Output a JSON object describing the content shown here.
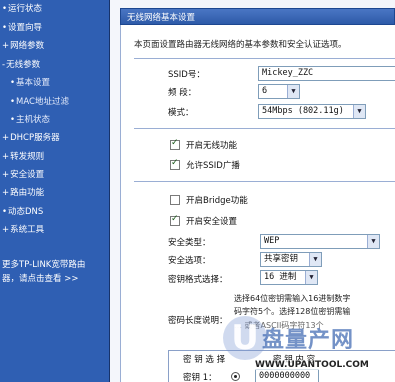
{
  "sidebar": {
    "items": [
      {
        "label": "运行状态",
        "bullet": "•"
      },
      {
        "label": "设置向导",
        "bullet": "•"
      },
      {
        "label": "网络参数",
        "bullet": "+"
      },
      {
        "label": "无线参数",
        "bullet": "-"
      },
      {
        "label": "基本设置",
        "bullet": "•"
      },
      {
        "label": "MAC地址过滤",
        "bullet": "•"
      },
      {
        "label": "主机状态",
        "bullet": "•"
      },
      {
        "label": "DHCP服务器",
        "bullet": "+"
      },
      {
        "label": "转发规则",
        "bullet": "+"
      },
      {
        "label": "安全设置",
        "bullet": "+"
      },
      {
        "label": "路由功能",
        "bullet": "+"
      },
      {
        "label": "动态DNS",
        "bullet": "•"
      },
      {
        "label": "系统工具",
        "bullet": "+"
      }
    ],
    "promo_line1": "更多TP-LINK宽带路由",
    "promo_line2": "器，请点击查看 >>"
  },
  "panel": {
    "title": "无线网络基本设置",
    "description": "本页面设置路由器无线网络的基本参数和安全认证选项。"
  },
  "form": {
    "ssid_label": "SSID号：",
    "ssid_value": "Mickey_ZZC",
    "channel_label": "频 段：",
    "channel_value": "6",
    "mode_label": "模式：",
    "mode_value": "54Mbps (802.11g)",
    "enable_wireless_label": "开启无线功能",
    "enable_wireless_checked": true,
    "allow_ssid_broadcast_label": "允许SSID广播",
    "allow_ssid_broadcast_checked": true,
    "enable_bridge_label": "开启Bridge功能",
    "enable_bridge_checked": false,
    "enable_security_label": "开启安全设置",
    "enable_security_checked": true,
    "security_type_label": "安全类型：",
    "security_type_value": "WEP",
    "security_option_label": "安全选项：",
    "security_option_value": "共享密钥",
    "key_format_label": "密钥格式选择：",
    "key_format_value": "16 进制",
    "key_length_label": "密码长度说明：",
    "key_length_help_1": "选择64位密钥需输入16进制数字",
    "key_length_help_2": "码字符5个。选择128位密钥需输",
    "key_length_help_3": "… 或者ASCII码字符13个",
    "key_table_header_select": "密 钥 选 择",
    "key_table_header_content": "密 钥 内 容",
    "key1_label": "密钥 1：",
    "key1_value": "0000000000"
  },
  "watermark": {
    "logo_letter": "U",
    "title": "盘量产网",
    "url": "WWW.UPANTOOL.COM"
  },
  "colors": {
    "sidebar_bg": "#2f5fb3",
    "titlebar_bg": "#3a66b8",
    "panel_bg": "#ffffff"
  }
}
